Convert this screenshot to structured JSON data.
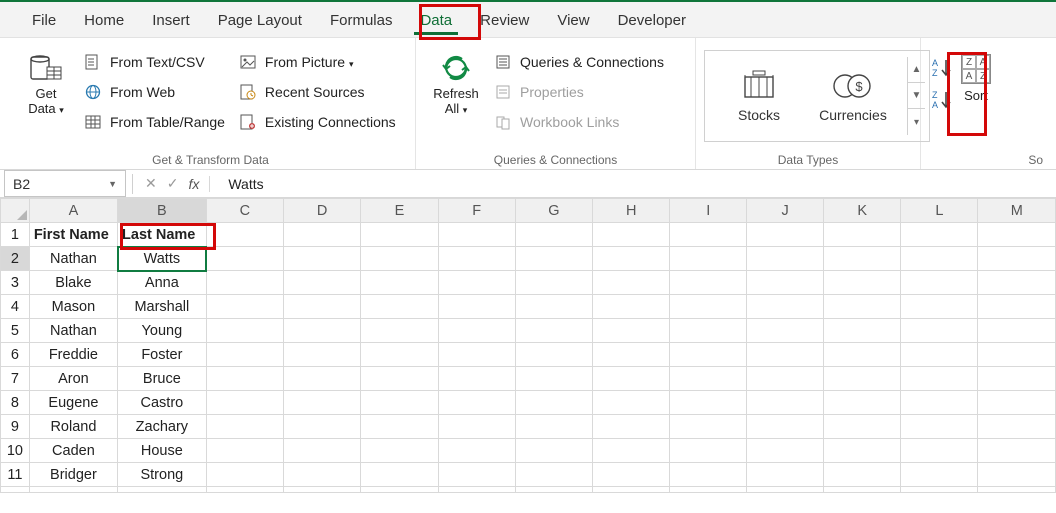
{
  "tabs": {
    "file": "File",
    "home": "Home",
    "insert": "Insert",
    "pagelayout": "Page Layout",
    "formulas": "Formulas",
    "data": "Data",
    "review": "Review",
    "view": "View",
    "developer": "Developer"
  },
  "ribbon": {
    "getdata": {
      "label": "Get",
      "label2": "Data"
    },
    "fromtextcsv": "From Text/CSV",
    "fromweb": "From Web",
    "fromtable": "From Table/Range",
    "frompic": "From Picture",
    "recent": "Recent Sources",
    "existing": "Existing Connections",
    "group1": "Get & Transform Data",
    "refresh": {
      "l1": "Refresh",
      "l2": "All"
    },
    "qac": "Queries & Connections",
    "props": "Properties",
    "wlinks": "Workbook Links",
    "group2": "Queries & Connections",
    "stocks": "Stocks",
    "currencies": "Currencies",
    "group3": "Data Types",
    "sort": "Sort",
    "group4": "So"
  },
  "namebox": "B2",
  "fx_value": "Watts",
  "columns": [
    "A",
    "B",
    "C",
    "D",
    "E",
    "F",
    "G",
    "H",
    "I",
    "J",
    "K",
    "L",
    "M"
  ],
  "headers": {
    "a": "First Name",
    "b": "Last Name"
  },
  "rows": [
    {
      "n": "1",
      "a_key": "headers.a",
      "b_key": "headers.b",
      "bold": true
    },
    {
      "n": "2",
      "a": "Nathan",
      "b": "Watts",
      "sel": true
    },
    {
      "n": "3",
      "a": "Blake",
      "b": "Anna"
    },
    {
      "n": "4",
      "a": "Mason",
      "b": "Marshall"
    },
    {
      "n": "5",
      "a": "Nathan",
      "b": "Young"
    },
    {
      "n": "6",
      "a": "Freddie",
      "b": "Foster"
    },
    {
      "n": "7",
      "a": "Aron",
      "b": "Bruce"
    },
    {
      "n": "8",
      "a": "Eugene",
      "b": "Castro"
    },
    {
      "n": "9",
      "a": "Roland",
      "b": "Zachary"
    },
    {
      "n": "10",
      "a": "Caden",
      "b": "House"
    },
    {
      "n": "11",
      "a": "Bridger",
      "b": "Strong"
    }
  ]
}
